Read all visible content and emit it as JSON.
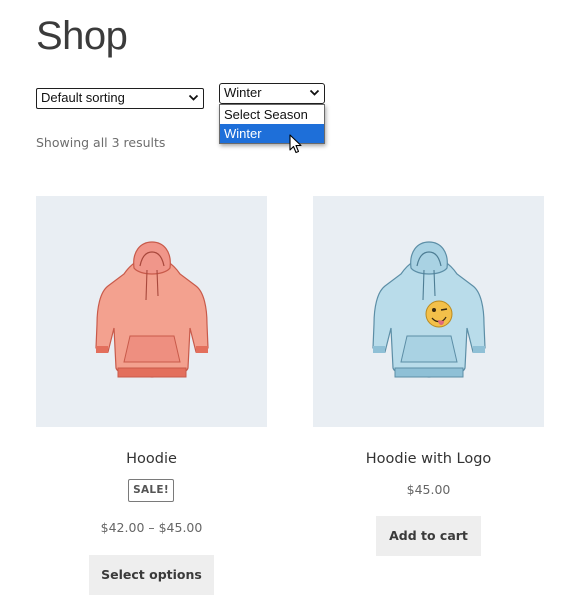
{
  "page": {
    "title": "Shop"
  },
  "sorting": {
    "selected": "Default sorting"
  },
  "season_filter": {
    "selected": "Winter",
    "options": [
      "Select Season",
      "Winter"
    ],
    "highlighted": "Winter"
  },
  "results": {
    "count_text": "Showing all 3 results"
  },
  "products": [
    {
      "name": "Hoodie",
      "badge": "SALE!",
      "price": "$42.00 – $45.00",
      "button": "Select options",
      "image_icon": "red-hoodie-icon",
      "color": "#f3a18f"
    },
    {
      "name": "Hoodie with Logo",
      "price": "$45.00",
      "button": "Add to cart",
      "image_icon": "blue-hoodie-with-emoji-logo-icon",
      "color": "#a9d2e3"
    }
  ],
  "colors": {
    "accent_highlight": "#1e6fd9",
    "image_background": "#e9eef3",
    "button_background": "#eeeeee"
  }
}
